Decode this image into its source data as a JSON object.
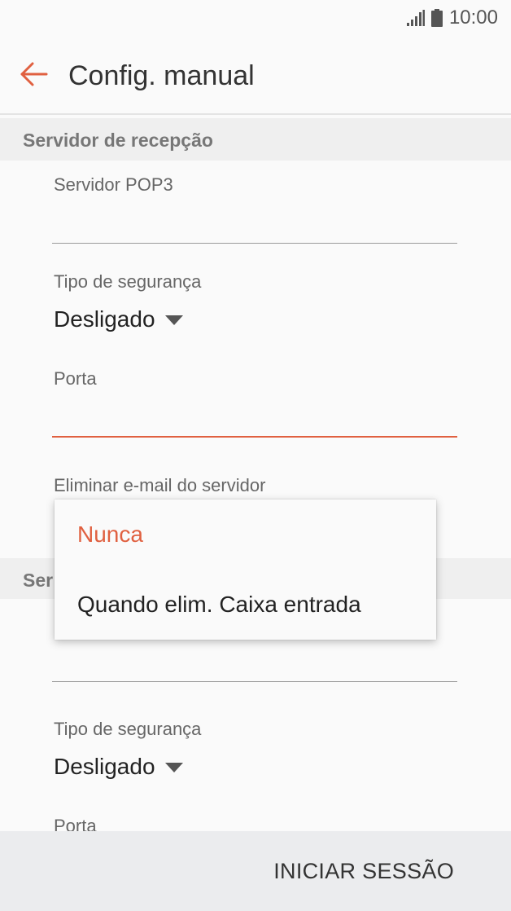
{
  "status_bar": {
    "time": "10:00"
  },
  "app_bar": {
    "title": "Config. manual"
  },
  "incoming": {
    "section_title": "Servidor de recepção",
    "server_label": "Servidor POP3",
    "server_value": "",
    "security_label": "Tipo de segurança",
    "security_value": "Desligado",
    "port_label": "Porta",
    "port_value": "",
    "delete_label": "Eliminar e-mail do servidor"
  },
  "popup": {
    "options": [
      "Nunca",
      "Quando elim. Caixa entrada"
    ],
    "selected": "Nunca"
  },
  "outgoing": {
    "section_title_visible": "Ser",
    "security_label": "Tipo de segurança",
    "security_value": "Desligado",
    "port_label": "Porta"
  },
  "bottom_bar": {
    "sign_in_label": "INICIAR SESSÃO"
  },
  "colors": {
    "accent": "#e06040",
    "background": "#fafafa",
    "section_bg": "#efefef",
    "bottom_bar_bg": "#ebecee"
  },
  "icons": {
    "back": "arrow-left-icon",
    "signal": "signal-icon",
    "battery": "battery-icon",
    "dropdown": "triangle-down-icon"
  }
}
